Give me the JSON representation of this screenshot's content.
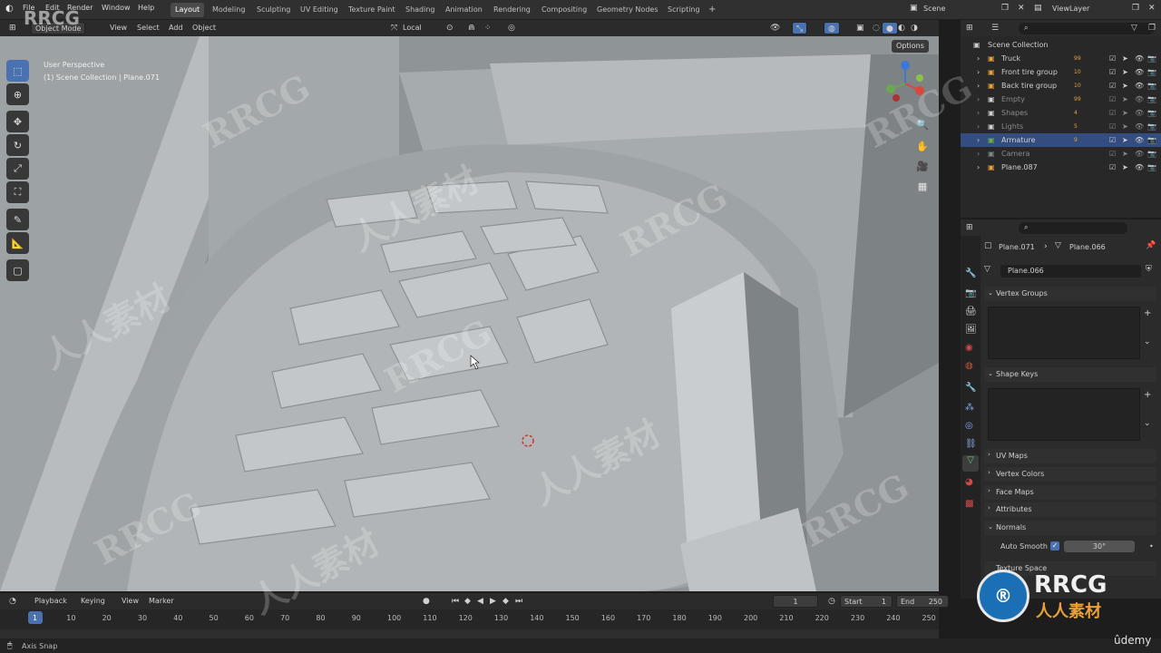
{
  "app": {
    "watermark_top": "RRCG",
    "watermark_text": "人人素材",
    "watermark_rrcg": "RRCG",
    "logo_big": "RRCG",
    "logo_small": "人人素材",
    "udemy": "ûdemy"
  },
  "topbar": {
    "menus": [
      "File",
      "Edit",
      "Render",
      "Window",
      "Help"
    ],
    "workspaces": [
      "Layout",
      "Modeling",
      "Sculpting",
      "UV Editing",
      "Texture Paint",
      "Shading",
      "Animation",
      "Rendering",
      "Compositing",
      "Geometry Nodes",
      "Scripting"
    ],
    "active_workspace": "Layout",
    "scene": "Scene",
    "view_layer": "ViewLayer"
  },
  "viewport_header": {
    "mode": "Object Mode",
    "menus": [
      "View",
      "Select",
      "Add",
      "Object"
    ],
    "orientation": "Local",
    "options": "Options"
  },
  "viewport": {
    "perspective": "User Perspective",
    "collection_path": "(1) Scene Collection | Plane.071"
  },
  "outliner": {
    "root": "Scene Collection",
    "items": [
      {
        "label": "Truck",
        "badge": "99"
      },
      {
        "label": "Front tire group",
        "badge": "10"
      },
      {
        "label": "Back tire group",
        "badge": "10"
      },
      {
        "label": "Empty",
        "badge": "99"
      },
      {
        "label": "Shapes",
        "badge": "4"
      },
      {
        "label": "Lights",
        "badge": "5"
      },
      {
        "label": "Armature",
        "badge": "9"
      },
      {
        "label": "Camera",
        "badge": ""
      },
      {
        "label": "Plane.087",
        "badge": ""
      }
    ]
  },
  "properties": {
    "breadcrumb_object": "Plane.071",
    "breadcrumb_data": "Plane.066",
    "mesh_name": "Plane.066",
    "panels": [
      "Vertex Groups",
      "Shape Keys",
      "UV Maps",
      "Vertex Colors",
      "Face Maps",
      "Attributes",
      "Normals",
      "Texture Space"
    ],
    "auto_smooth_label": "Auto Smooth",
    "auto_smooth_angle": "30°"
  },
  "timeline": {
    "menus": [
      "Playback",
      "Keying",
      "View",
      "Marker"
    ],
    "current_frame": "1",
    "start_label": "Start",
    "start": "1",
    "end_label": "End",
    "end": "250",
    "ticks": [
      "1",
      "10",
      "20",
      "30",
      "40",
      "50",
      "60",
      "70",
      "80",
      "90",
      "100",
      "110",
      "120",
      "130",
      "140",
      "150",
      "160",
      "170",
      "180",
      "190",
      "200",
      "210",
      "220",
      "230",
      "240",
      "250"
    ]
  },
  "status": {
    "left": "Axis Snap"
  }
}
